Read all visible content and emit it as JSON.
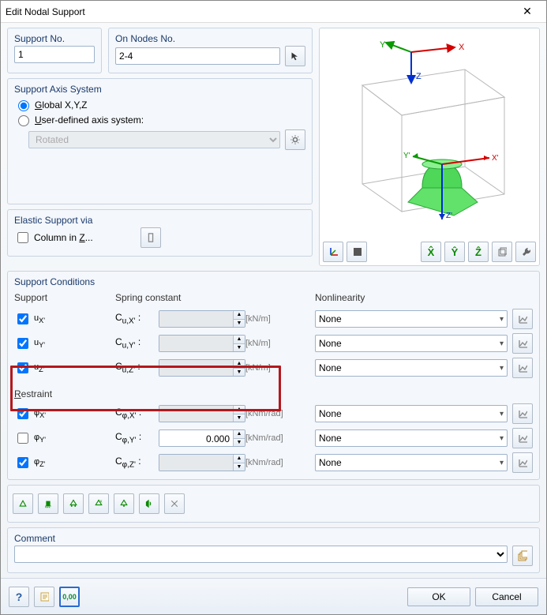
{
  "window": {
    "title": "Edit Nodal Support"
  },
  "support_no": {
    "label": "Support No.",
    "value": "1"
  },
  "on_nodes": {
    "label": "On Nodes No.",
    "value": "2-4"
  },
  "axis_system": {
    "title": "Support Axis System",
    "global_label": "Global X,Y,Z",
    "user_label": "User-defined axis system:",
    "selected": "global",
    "user_mode_value": "Rotated"
  },
  "elastic": {
    "title": "Elastic Support via",
    "column_label": "Column in Z...",
    "column_checked": false
  },
  "conditions": {
    "title": "Support Conditions",
    "headers": {
      "support": "Support",
      "spring": "Spring constant",
      "nonlin": "Nonlinearity"
    },
    "restraint_header": "Restraint",
    "rows": [
      {
        "check": true,
        "axis": "uX'",
        "c_label": "Cu,X' :",
        "value": "",
        "enabled": false,
        "unit": "[kN/m]",
        "nonlin": "None"
      },
      {
        "check": true,
        "axis": "uY'",
        "c_label": "Cu,Y' :",
        "value": "",
        "enabled": false,
        "unit": "[kN/m]",
        "nonlin": "None"
      },
      {
        "check": true,
        "axis": "uZ'",
        "c_label": "Cu,Z' :",
        "value": "",
        "enabled": false,
        "unit": "[kN/m]",
        "nonlin": "None"
      },
      {
        "check": true,
        "axis": "φX'",
        "c_label": "Cφ,X' :",
        "value": "",
        "enabled": false,
        "unit": "[kNm/rad]",
        "nonlin": "None"
      },
      {
        "check": false,
        "axis": "φY'",
        "c_label": "Cφ,Y' :",
        "value": "0.000",
        "enabled": true,
        "unit": "[kNm/rad]",
        "nonlin": "None"
      },
      {
        "check": true,
        "axis": "φZ'",
        "c_label": "Cφ,Z' :",
        "value": "",
        "enabled": false,
        "unit": "[kNm/rad]",
        "nonlin": "None"
      }
    ]
  },
  "comment": {
    "title": "Comment",
    "value": ""
  },
  "buttons": {
    "ok": "OK",
    "cancel": "Cancel"
  },
  "axes_labels": {
    "x": "X",
    "y": "Y",
    "z": "Z",
    "xp": "X'",
    "yp": "Y'",
    "zp": "Z'"
  },
  "preview_tools": [
    "view-local-axes",
    "view-mode",
    "align-x",
    "align-y",
    "align-z",
    "view-cube",
    "view-reset"
  ],
  "preset_tools": [
    "preset-hinged",
    "preset-fixed",
    "preset-roller-x",
    "preset-roller-xy",
    "preset-roller-z",
    "preset-sound",
    "preset-free"
  ]
}
